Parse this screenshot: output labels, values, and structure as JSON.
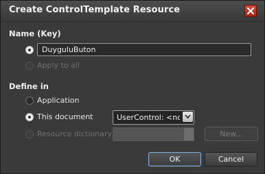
{
  "dialog": {
    "title": "Create ControlTemplate Resource",
    "close_icon": "close-icon"
  },
  "name_section": {
    "label": "Name (Key)",
    "name_value": "DuyguluButon",
    "apply_to_all": "Apply to all"
  },
  "define_section": {
    "label": "Define in",
    "options": {
      "application": "Application",
      "this_document": "This document",
      "resource_dictionary": "Resource dictionary"
    },
    "document_selected": "UserControl: <no na",
    "new_button": "New..."
  },
  "footer": {
    "ok": "OK",
    "cancel": "Cancel"
  },
  "colors": {
    "background": "#3a3a3a",
    "title_bar": "#444444",
    "close_red": "#c0392b",
    "default_button_border": "#8eaed0"
  }
}
